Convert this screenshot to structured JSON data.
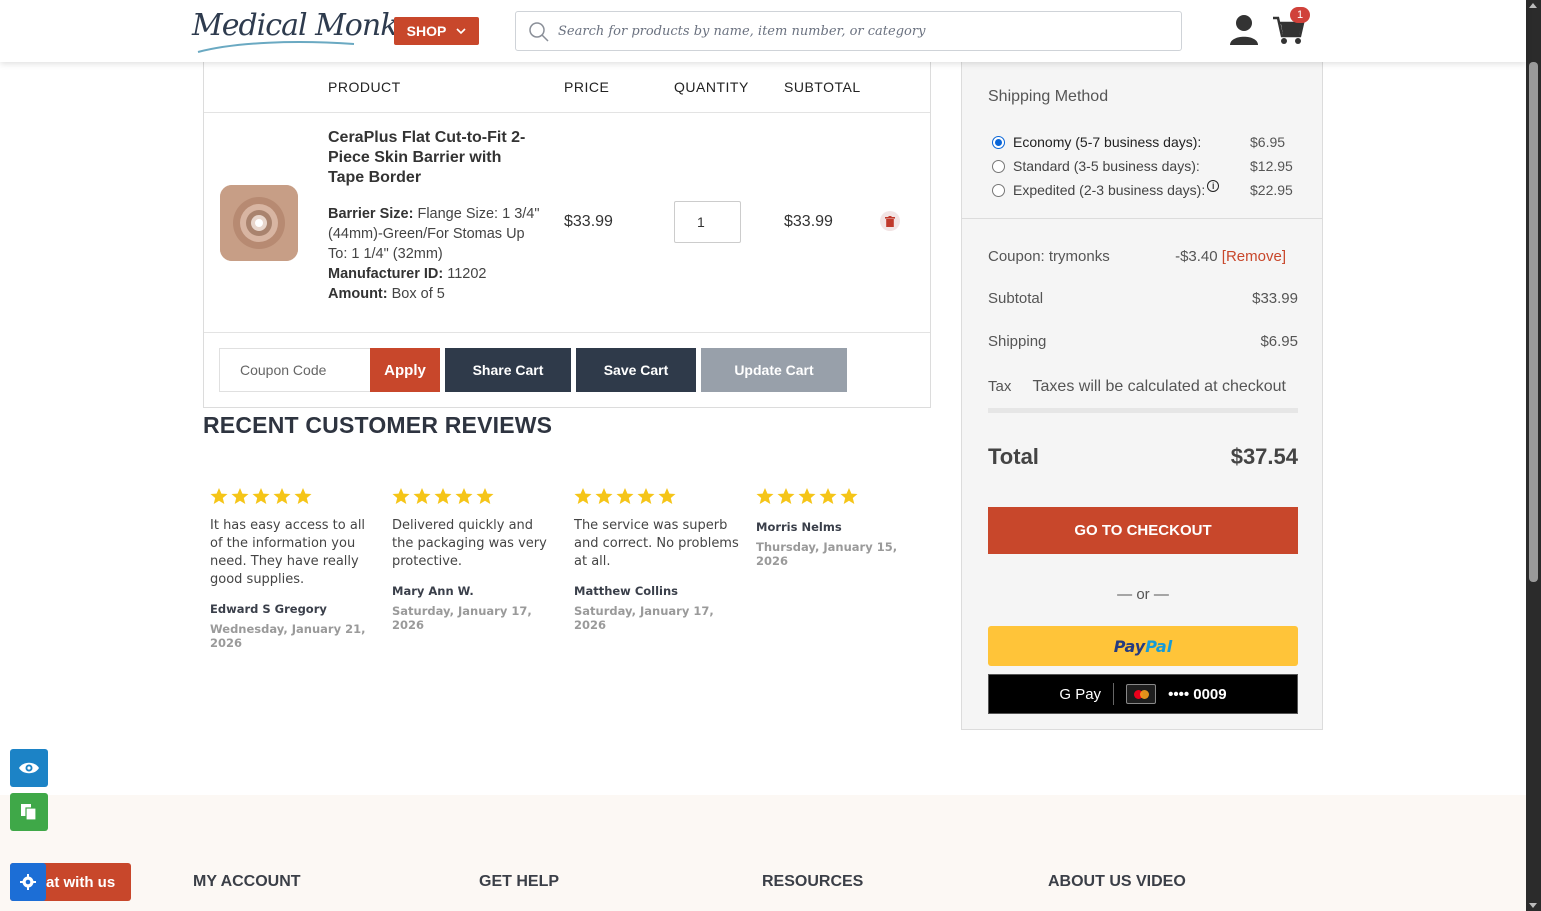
{
  "header": {
    "logo_text": "Medical Monks",
    "shop_label": "SHOP",
    "search_placeholder": "Search for products by name, item number, or category",
    "cart_count": "1"
  },
  "cart": {
    "columns": {
      "product": "PRODUCT",
      "price": "PRICE",
      "quantity": "QUANTITY",
      "subtotal": "SUBTOTAL"
    },
    "item": {
      "name": "CeraPlus Flat Cut-to-Fit 2-Piece Skin Barrier with Tape Border",
      "attrs": [
        {
          "label": "Barrier Size:",
          "value": "Flange Size: 1 3/4\" (44mm)-Green/For Stomas Up To: 1 1/4\" (32mm)"
        },
        {
          "label": "Manufacturer ID:",
          "value": "11202"
        },
        {
          "label": "Amount:",
          "value": "Box of 5"
        }
      ],
      "price": "$33.99",
      "quantity": "1",
      "subtotal": "$33.99"
    },
    "coupon_placeholder": "Coupon Code",
    "apply_label": "Apply",
    "share_label": "Share Cart",
    "save_label": "Save Cart",
    "update_label": "Update Cart"
  },
  "reviews": {
    "title": "RECENT CUSTOMER REVIEWS",
    "star_color": "#f5c518",
    "items": [
      {
        "stars": 5,
        "text": "It has easy access to all of the information you need. They have really good supplies.",
        "author": "Edward S Gregory",
        "date": "Wednesday, January 21, 2026"
      },
      {
        "stars": 5,
        "text": "Delivered quickly and the packaging was very protective.",
        "author": "Mary Ann W.",
        "date": "Saturday, January 17, 2026"
      },
      {
        "stars": 5,
        "text": "The service was superb and correct. No problems at all.",
        "author": "Matthew Collins",
        "date": "Saturday, January 17, 2026"
      },
      {
        "stars": 5,
        "text": "",
        "author": "Morris Nelms",
        "date": "Thursday, January 15, 2026"
      }
    ]
  },
  "summary": {
    "shipping_title": "Shipping Method",
    "shipping_options": [
      {
        "label": "Economy (5-7 business days):",
        "price": "$6.95",
        "selected": true
      },
      {
        "label": "Standard (3-5 business days):",
        "price": "$12.95",
        "selected": false
      },
      {
        "label": "Expedited (2-3 business days):",
        "price": "$22.95",
        "selected": false
      }
    ],
    "coupon_label": "Coupon: trymonks",
    "coupon_value": "-$3.40",
    "remove_label": "[Remove]",
    "subtotal_label": "Subtotal",
    "subtotal_value": "$33.99",
    "shipping_label": "Shipping",
    "shipping_value": "$6.95",
    "tax_label": "Tax",
    "tax_value": "Taxes will be calculated at checkout",
    "total_label": "Total",
    "total_value": "$37.54",
    "checkout_label": "GO TO CHECKOUT",
    "or_text": "— or —",
    "paypal_label_1": "Pay",
    "paypal_label_2": "Pal",
    "gpay_label": "G Pay",
    "card_digits": "•••• 0009"
  },
  "footer": {
    "columns": [
      "MY ACCOUNT",
      "GET HELP",
      "RESOURCES",
      "ABOUT US VIDEO"
    ]
  },
  "widgets": {
    "chat_label": "at with us"
  },
  "colors": {
    "brand": "#c8472b",
    "dark_button": "#2f3a4a",
    "disabled_button": "#98a0aa"
  }
}
